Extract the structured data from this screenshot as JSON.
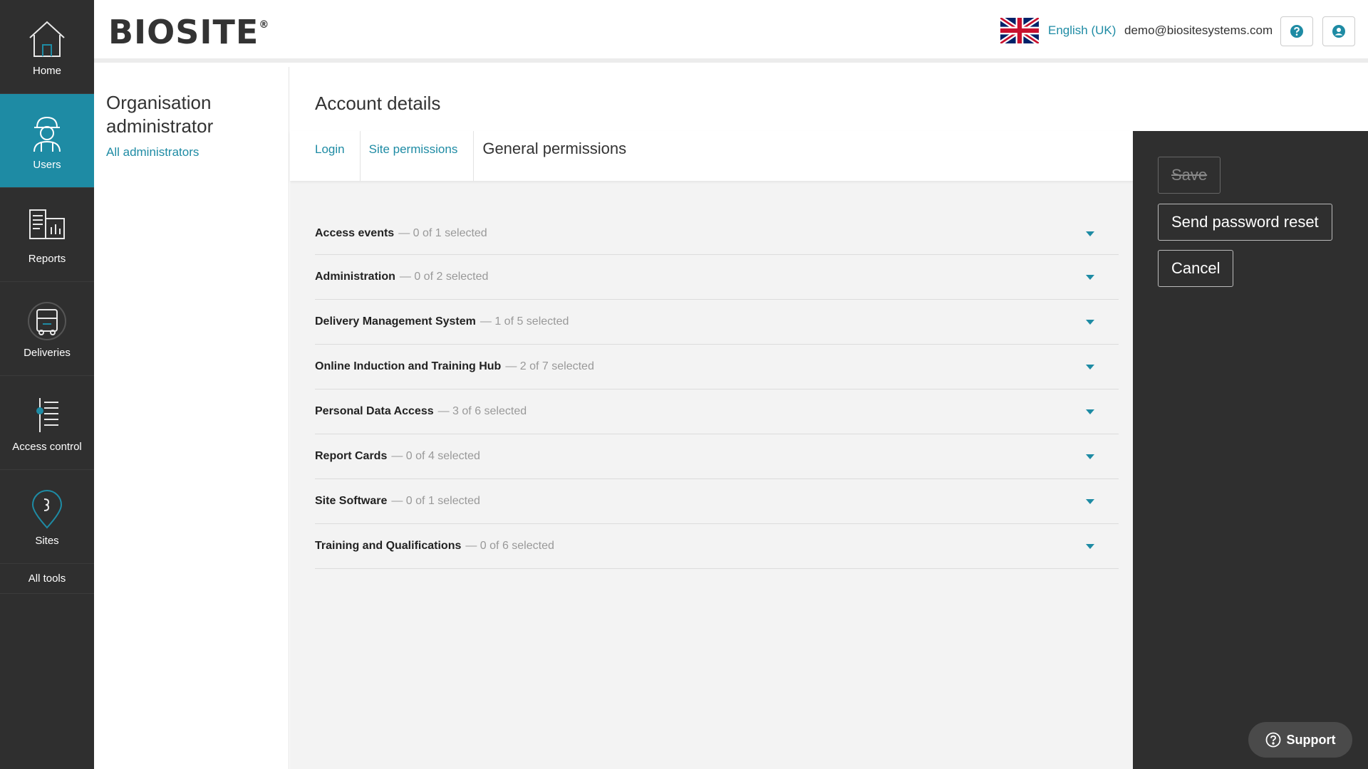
{
  "nav": {
    "items": [
      {
        "label": "Home",
        "icon": "home-icon"
      },
      {
        "label": "Users",
        "icon": "worker-icon",
        "active": true
      },
      {
        "label": "Reports",
        "icon": "reports-icon"
      },
      {
        "label": "Deliveries",
        "icon": "truck-icon"
      },
      {
        "label": "Access control",
        "icon": "turnstile-icon"
      },
      {
        "label": "Sites",
        "icon": "map-pin-icon"
      }
    ],
    "all_tools": "All tools"
  },
  "header": {
    "logo": "BIOSITE",
    "logo_mark": "®",
    "language": "English (UK)",
    "email": "demo@biositesystems.com",
    "colors": {
      "accent": "#1e8ba4",
      "nav_bg": "#2f2f2f"
    }
  },
  "side": {
    "title": "Organisation administrator",
    "link": "All administrators"
  },
  "main": {
    "title": "Account details",
    "tabs": [
      {
        "label": "Login"
      },
      {
        "label": "Site permissions"
      },
      {
        "label": "General permissions",
        "active": true
      }
    ],
    "permissions": [
      {
        "name": "Access events",
        "count": "— 0 of 1 selected"
      },
      {
        "name": "Administration",
        "count": "— 0 of 2 selected"
      },
      {
        "name": "Delivery Management System",
        "count": "— 1 of 5 selected"
      },
      {
        "name": "Online Induction and Training Hub",
        "count": "— 2 of 7 selected"
      },
      {
        "name": "Personal Data Access",
        "count": "— 3 of 6 selected"
      },
      {
        "name": "Report Cards",
        "count": "— 0 of 4 selected"
      },
      {
        "name": "Site Software",
        "count": "— 0 of 1 selected"
      },
      {
        "name": "Training and Qualifications",
        "count": "— 0 of 6 selected"
      }
    ]
  },
  "actions": {
    "save": "Save",
    "reset": "Send password reset",
    "cancel": "Cancel"
  },
  "support": "Support"
}
